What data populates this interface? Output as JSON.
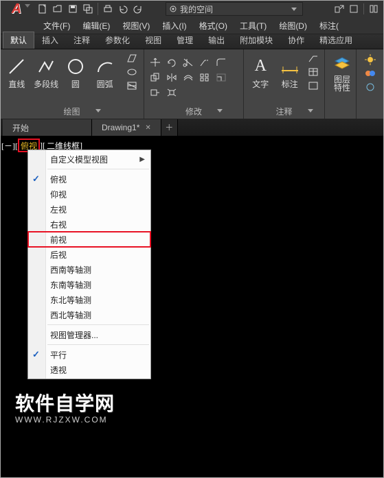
{
  "workspace_label": "我的空间",
  "menubar": [
    "文件(F)",
    "编辑(E)",
    "视图(V)",
    "插入(I)",
    "格式(O)",
    "工具(T)",
    "绘图(D)",
    "标注("
  ],
  "ribbon_tabs": [
    "默认",
    "插入",
    "注释",
    "参数化",
    "视图",
    "管理",
    "输出",
    "附加模块",
    "协作",
    "精选应用"
  ],
  "panel_draw": {
    "title": "绘图",
    "big": [
      "直线",
      "多段线",
      "圆",
      "圆弧"
    ]
  },
  "panel_modify": {
    "title": "修改"
  },
  "panel_anno": {
    "title": "注释",
    "big": [
      "文字",
      "标注"
    ]
  },
  "panel_layer": {
    "label": "图层\n特性"
  },
  "doc_tabs": {
    "start": "开始",
    "drawing": "Drawing1*"
  },
  "view_label": {
    "current": "俯视",
    "style": "二维线框"
  },
  "ctx": {
    "custom": "自定义模型视图",
    "views": [
      "俯视",
      "仰视",
      "左视",
      "右视",
      "前视",
      "后视",
      "西南等轴测",
      "东南等轴测",
      "东北等轴测",
      "西北等轴测"
    ],
    "manager": "视图管理器...",
    "proj": [
      "平行",
      "透视"
    ],
    "checked": [
      "俯视",
      "平行"
    ],
    "highlighted": "前视"
  },
  "watermark": {
    "cn": "软件自学网",
    "en": "WWW.RJZXW.COM"
  }
}
